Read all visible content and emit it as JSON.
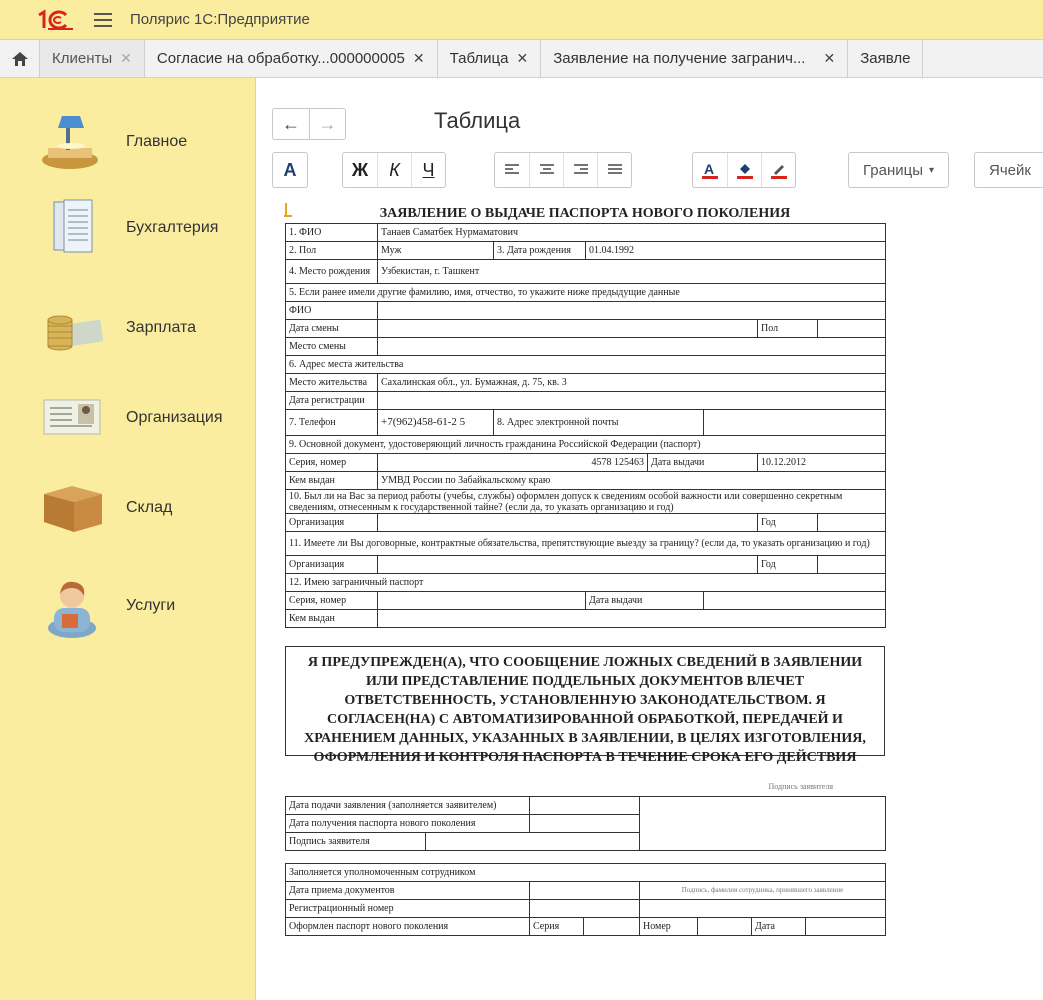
{
  "app": {
    "logo_text": "1С",
    "title": "Полярис 1С:Предприятие"
  },
  "tabs": [
    {
      "label": "Клиенты",
      "active": false
    },
    {
      "label": "Согласие на обработку...000000005",
      "active": true
    },
    {
      "label": "Таблица",
      "active": true
    },
    {
      "label": "Заявление на получение загранич...",
      "active": true
    },
    {
      "label": "Заявле",
      "active": true
    }
  ],
  "sidebar": {
    "items": [
      {
        "label": "Главное",
        "icon": "desk-lamp-icon"
      },
      {
        "label": "Бухгалтерия",
        "icon": "documents-icon"
      },
      {
        "label": "Зарплата",
        "icon": "coins-icon"
      },
      {
        "label": "Организация",
        "icon": "id-card-icon"
      },
      {
        "label": "Склад",
        "icon": "box-icon"
      },
      {
        "label": "Услуги",
        "icon": "person-icon"
      }
    ]
  },
  "header": {
    "title": "Таблица",
    "back": "←",
    "forward": "→"
  },
  "toolbar": {
    "font": "A",
    "bold": "Ж",
    "italic": "К",
    "underline": "Ч",
    "borders": "Границы",
    "cells": "Ячейк"
  },
  "doc": {
    "heading": "ЗАЯВЛЕНИЕ О ВЫДАЧЕ ПАСПОРТА НОВОГО ПОКОЛЕНИЯ",
    "f1": "1. ФИО",
    "fio": "Танаев Саматбек Нурмаматович",
    "f2": "2. Пол",
    "sex": "Муж",
    "f3": "3. Дата рождения",
    "birth": "01.04.1992",
    "f4": "4. Место рождения",
    "birthplace": "Узбекистан, г. Ташкент",
    "f5": "5. Если ранее имели другие фамилию, имя, отчество, то укажите ниже предыдущие данные",
    "fio_lbl": "ФИО",
    "change_date": "Дата смены",
    "pol": "Пол",
    "change_place": "Место смены",
    "f6": "6. Адрес места жительства",
    "residence_lbl": "Место жительства",
    "residence": "Сахалинская обл., ул. Бумажная, д. 75, кв. 3",
    "reg_date": "Дата регистрации",
    "f7": "7. Телефон",
    "phone": "+7(962)458-61-2 5",
    "f8": "8. Адрес электронной почты",
    "f9": "9. Основной документ, удостоверяющий личность гражданина Российской Федерации (паспорт)",
    "series_lbl": "Серия, номер",
    "series": "4578 125463",
    "issue_date_lbl": "Дата выдачи",
    "issue_date": "10.12.2012",
    "issued_by_lbl": "Кем выдан",
    "issued_by": "УМВД России по Забайкальскому краю",
    "f10": "10. Был ли на Вас за период работы (учебы, службы) оформлен допуск к сведениям особой важности или совершенно секретным сведениям, отнесенным к государственной тайне? (если да, то указать организацию и год)",
    "org": "Организация",
    "year": "Год",
    "f11": "11. Имеете ли Вы договорные, контрактные обязательства, препятствующие выезду за границу? (если да, то указать организацию и год)",
    "f12": "12. Имею заграничный паспорт",
    "notice": "Я ПРЕДУПРЕЖДЕН(А), ЧТО СООБЩЕНИЕ ЛОЖНЫХ СВЕДЕНИЙ В ЗАЯВЛЕНИИ ИЛИ ПРЕДСТАВЛЕНИЕ ПОДДЕЛЬНЫХ ДОКУМЕНТОВ ВЛЕЧЕТ ОТВЕТСТВЕННОСТЬ, УСТАНОВЛЕННУЮ ЗАКОНОДАТЕЛЬСТВОМ. Я СОГЛАСЕН(НА) С АВТОМАТИЗИРОВАННОЙ ОБРАБОТКОЙ, ПЕРЕДАЧЕЙ И ХРАНЕНИЕМ ДАННЫХ, УКАЗАННЫХ В ЗАЯВЛЕНИИ, В ЦЕЛЯХ ИЗГОТОВЛЕНИЯ, ОФОРМЛЕНИЯ И КОНТРОЛЯ ПАСПОРТА В ТЕЧЕНИЕ СРОКА ЕГО ДЕЙСТВИЯ",
    "sig_caption": "Подпись заявителя",
    "submit_date": "Дата подачи заявления (заполняется заявителем)",
    "receive_date": "Дата получения паспорта нового поколения",
    "applicant_sig": "Подпись заявителя",
    "filled_by": "Заполняется уполномоченным сотрудником",
    "accept_date": "Дата приема документов",
    "employee_sig": "Подпись, фамилия сотрудника, принявшего заявление",
    "reg_number": "Регистрационный номер",
    "issued_passport": "Оформлен паспорт нового поколения",
    "seria": "Серия",
    "nomer": "Номер",
    "data": "Дата"
  }
}
